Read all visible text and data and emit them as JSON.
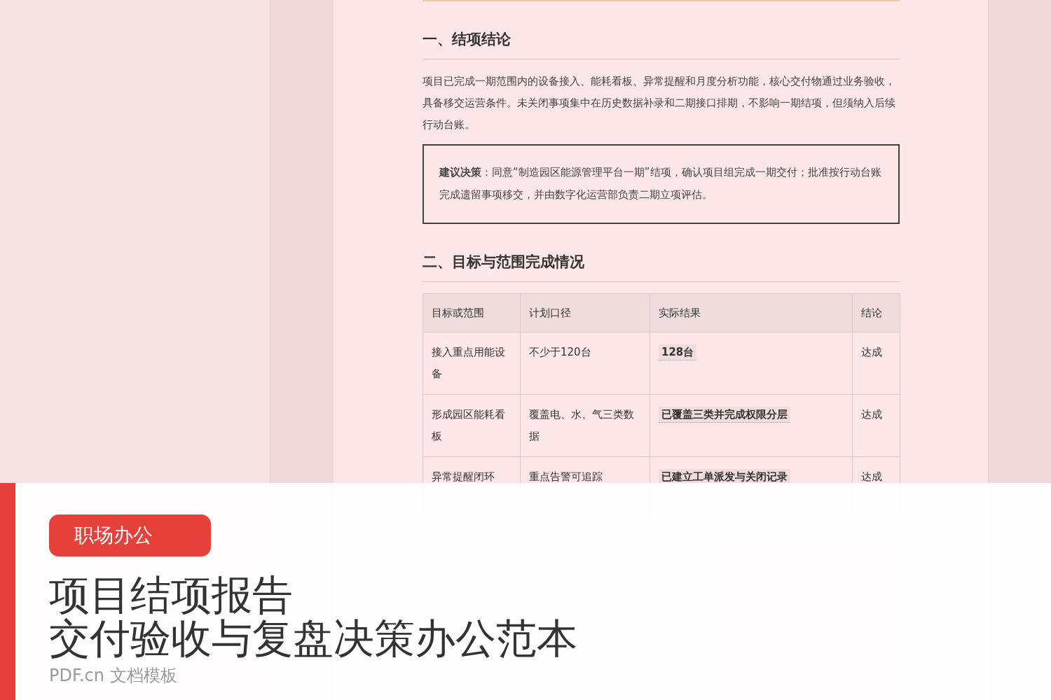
{
  "document": {
    "sections": [
      {
        "heading": "一、结项结论",
        "paragraph": "项目已完成一期范围内的设备接入、能耗看板、异常提醒和月度分析功能，核心交付物通过业务验收，具备移交运营条件。未关闭事项集中在历史数据补录和二期接口排期，不影响一期结项，但须纳入后续行动台账。",
        "callout": "**建议决策**：同意“制造园区能源管理平台一期”结项，确认项目组完成一期交付；批准按行动台账完成遗留事项移交，并由数字化运营部负责二期立项评估。"
      },
      {
        "heading": "二、目标与范围完成情况",
        "table": {
          "columns": [
            "目标或范围",
            "计划口径",
            "实际结果",
            "结论"
          ],
          "rows": [
            [
              "接入重点用能设备",
              "不少于120台",
              "128台",
              "达成"
            ],
            [
              "形成园区能耗看板",
              "覆盖电、水、气三类数据",
              "已覆盖三类并完成权限分层",
              "达成"
            ],
            [
              "异常提醒闭环",
              "重点告警可追踪",
              "已建立工单派发与关闭记录",
              "达成"
            ]
          ]
        }
      }
    ]
  },
  "banner": {
    "tag": "职场办公",
    "title_lines": [
      "项目结项报告",
      "交付验收与复盘决策办公范本"
    ],
    "subtitle": "PDF.cn 文档模板"
  }
}
